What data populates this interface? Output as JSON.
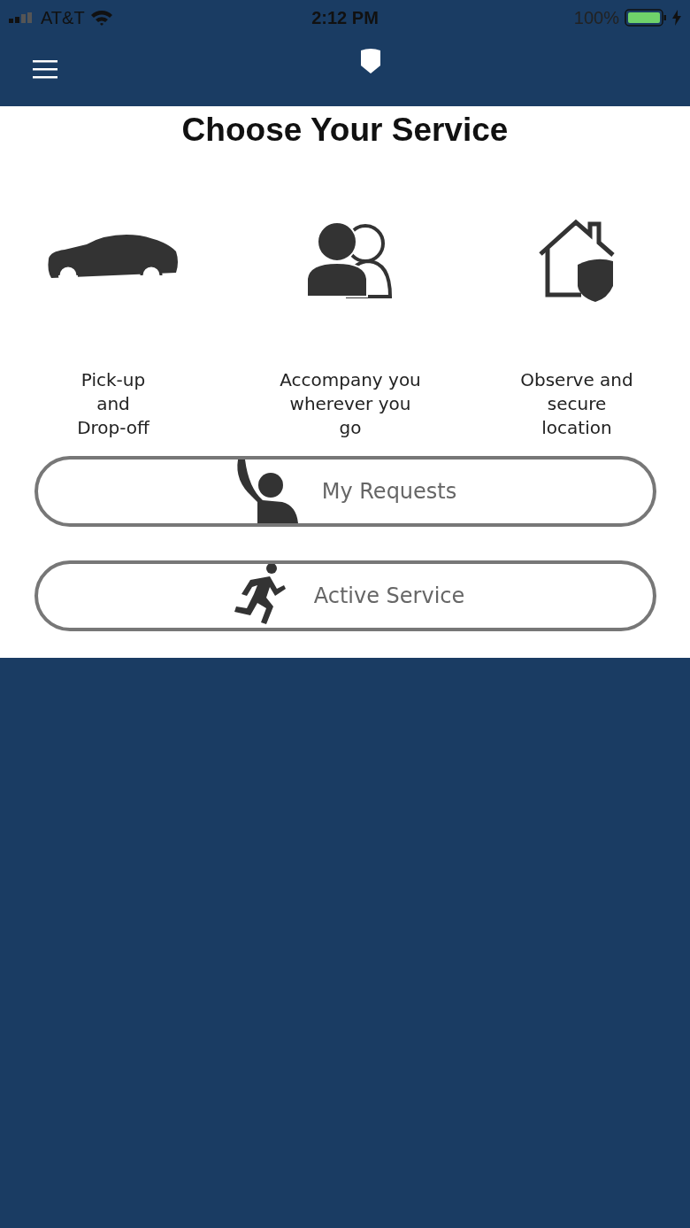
{
  "status_bar": {
    "carrier": "AT&T",
    "time": "2:12 PM",
    "battery": "100%"
  },
  "title": "Choose Your Service",
  "services": [
    {
      "kind": "car",
      "label": "Pick-up\nand\nDrop-off"
    },
    {
      "kind": "people",
      "label": "Accompany you\nwherever you\ngo"
    },
    {
      "kind": "house",
      "label": "Observe and\nsecure\nlocation"
    }
  ],
  "buttons": [
    {
      "kind": "wave",
      "label": "My Requests"
    },
    {
      "kind": "run",
      "label": "Active Service"
    }
  ]
}
